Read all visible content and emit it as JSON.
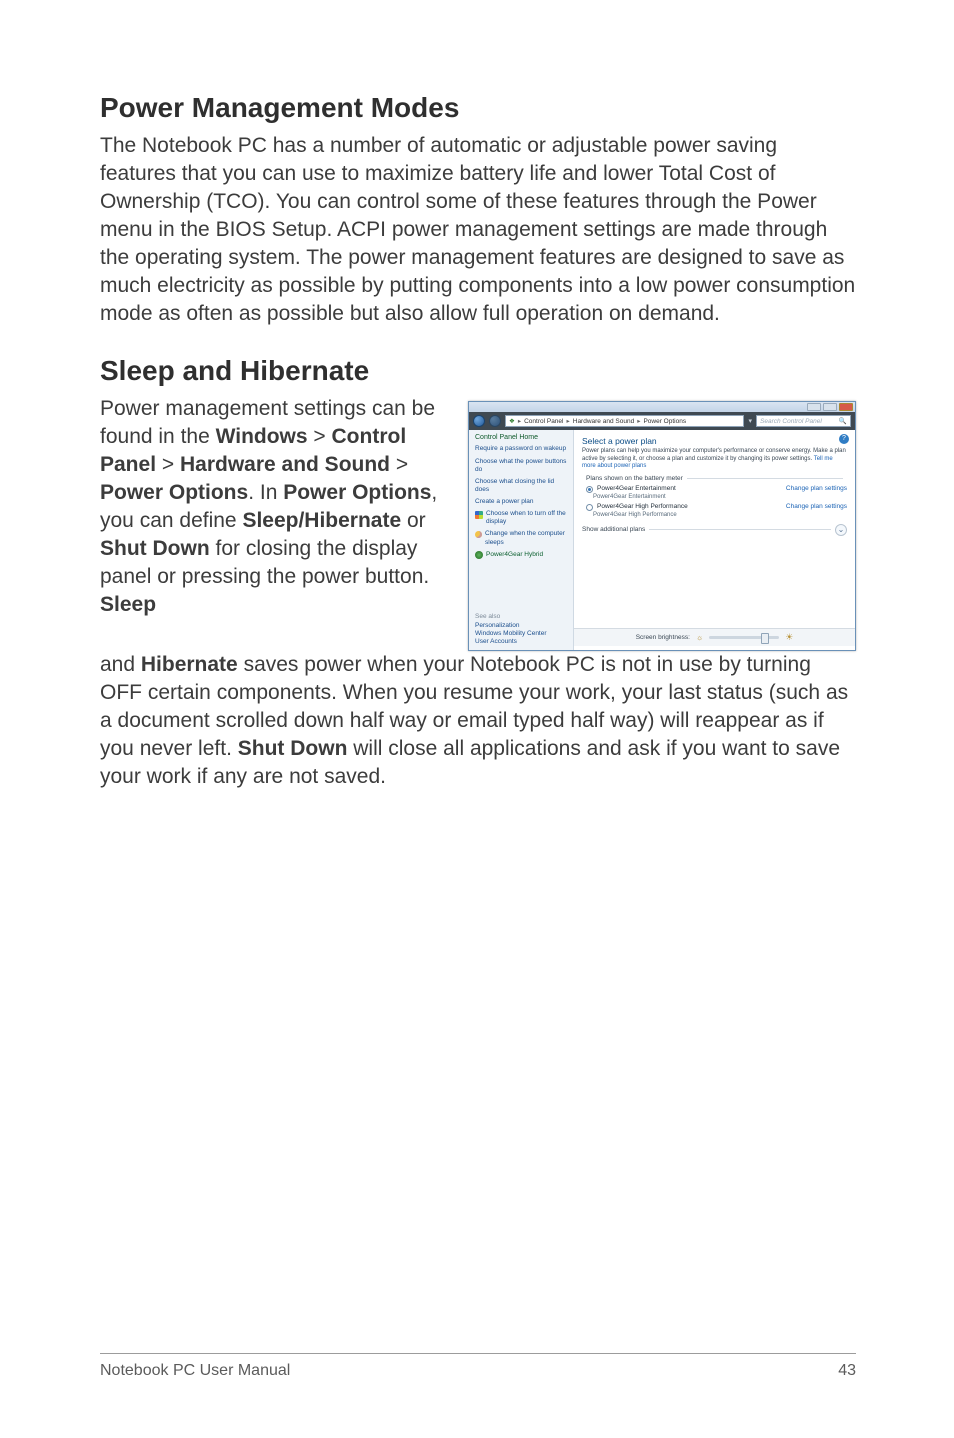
{
  "headings": {
    "power_modes": "Power Management Modes",
    "sleep_hibernate": "Sleep and Hibernate"
  },
  "paragraphs": {
    "p1": "The Notebook PC has a number of automatic or adjustable power saving features that you can use to maximize battery life and lower Total Cost of Ownership (TCO). You can control some of these features through the Power menu in the BIOS Setup. ACPI power management settings are made through the operating system. The power management features are designed to save as much electricity as possible by putting components into a low power consumption mode as often as possible but also allow full operation on demand.",
    "p2a": "Power management settings can be found in the ",
    "p2b_windows": "Windows",
    "p2c": " > ",
    "p2d_cp": "Control Panel",
    "p2e": " > ",
    "p2f_hw": "Hardware and Sound",
    "p2g": " > ",
    "p2h_po": "Power Options",
    "p2i": ". In ",
    "p2j_po2": "Power Options",
    "p2k": ", you can define ",
    "p2l_sh": "Sleep/Hibernate",
    "p2m": " or ",
    "p2n_sd": "Shut Down",
    "p2o": " for closing the display panel or pressing the power button. ",
    "p2p_sleep": "Sleep",
    "p3a": "and ",
    "p3b_hib": "Hibernate",
    "p3c": " saves power when your Notebook PC is not in use by turning OFF certain components. When you resume your work, your last status (such as a document scrolled down half way or email typed half way) will reappear as if you never left. ",
    "p3d_sd": "Shut Down",
    "p3e": " will close all applications and ask if you want to save your work if any are not saved."
  },
  "footer": {
    "left": "Notebook PC User Manual",
    "right": "43"
  },
  "screenshot": {
    "breadcrumb": {
      "cp": "Control Panel",
      "hw": "Hardware and Sound",
      "po": "Power Options"
    },
    "search_placeholder": "Search Control Panel",
    "sidebar": {
      "home": "Control Panel Home",
      "links": [
        "Require a password on wakeup",
        "Choose what the power buttons do",
        "Choose what closing the lid does",
        "Create a power plan",
        "Choose when to turn off the display",
        "Change when the computer sleeps"
      ],
      "hybrid": "Power4Gear Hybrid",
      "see_also_hdr": "See also",
      "see_also": [
        "Personalization",
        "Windows Mobility Center",
        "User Accounts"
      ]
    },
    "main": {
      "title": "Select a power plan",
      "desc": "Power plans can help you maximize your computer's performance or conserve energy. Make a plan active by selecting it, or choose a plan and customize it by changing its power settings. ",
      "tell_more": "Tell me more about power plans",
      "fieldset_label": "Plans shown on the battery meter",
      "plan1": {
        "name": "Power4Gear Entertainment",
        "sub": "Power4Gear Entertainment",
        "change": "Change plan settings"
      },
      "plan2": {
        "name": "Power4Gear High Performance",
        "sub": "Power4Gear High Performance",
        "change": "Change plan settings"
      },
      "additional": "Show additional plans",
      "brightness_label": "Screen brightness:"
    }
  }
}
